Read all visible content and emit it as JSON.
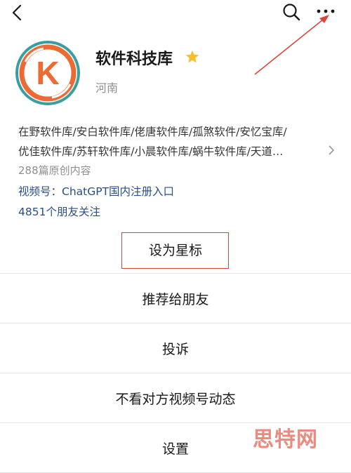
{
  "nav": {
    "back_icon": "chevron-left-icon",
    "search_icon": "search-icon",
    "more_icon": "more-dots-icon"
  },
  "profile": {
    "name": "软件科技库",
    "region": "河南",
    "avatar_letter": "K",
    "description_lines": [
      "在野软件库/安白软件库/佬唐软件库/孤煞软件/安忆宝库/",
      "优佳软件库/苏轩软件库/小晨软件库/蜗牛软件库/天道…"
    ],
    "original_count": "288篇原创内容",
    "channel": "视频号：ChatGPT国内注册入口",
    "followers": "4851个朋友关注"
  },
  "menu": {
    "items": [
      {
        "label": "设为星标"
      },
      {
        "label": "推荐给朋友"
      },
      {
        "label": "投诉"
      },
      {
        "label": "不看对方视频号动态"
      },
      {
        "label": "设置"
      }
    ]
  },
  "watermark": "思特网",
  "colors": {
    "link_blue": "#2a4f86",
    "annotation_red": "#d9453b",
    "star_yellow": "#f5c02b",
    "avatar_orange": "#ec6b35",
    "avatar_teal": "#3a9ea1"
  }
}
